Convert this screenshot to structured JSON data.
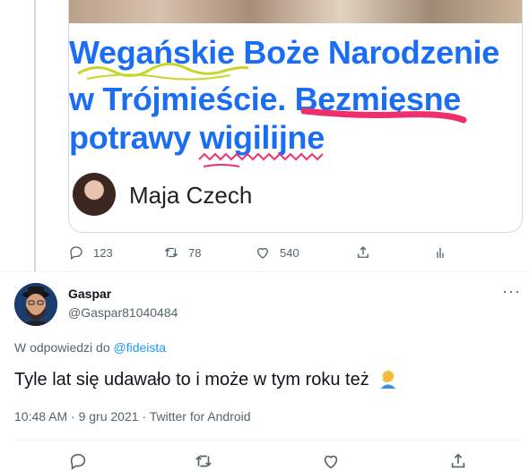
{
  "quoted_card": {
    "headline_lines": [
      "Wegańskie Boże Narodzenie",
      "w Trójmieście. Bezmięsne",
      "potrawy wigilijne"
    ],
    "author_name": "Maja Czech"
  },
  "parent_actions": {
    "replies": "123",
    "retweets": "78",
    "likes": "540"
  },
  "tweet": {
    "display_name": "Gaspar",
    "handle": "@Gaspar81040484",
    "more_label": "···",
    "reply_prefix": "W odpowiedzi do",
    "reply_to": "@fideista",
    "text": "Tyle lat się udawało to i może w tym roku też",
    "timestamp": "10:48 AM · 9 gru 2021 · ",
    "source": "Twitter for Android"
  },
  "icons": {
    "reply": "reply-icon",
    "retweet": "retweet-icon",
    "like": "heart-icon",
    "share": "share-icon",
    "analytics": "analytics-icon",
    "facepalm": "facepalm-emoji"
  },
  "colors": {
    "headline_blue": "#1b6ef3",
    "underline_pink": "#ee2f6b",
    "link": "#1d9bf0",
    "muted": "#536471"
  }
}
